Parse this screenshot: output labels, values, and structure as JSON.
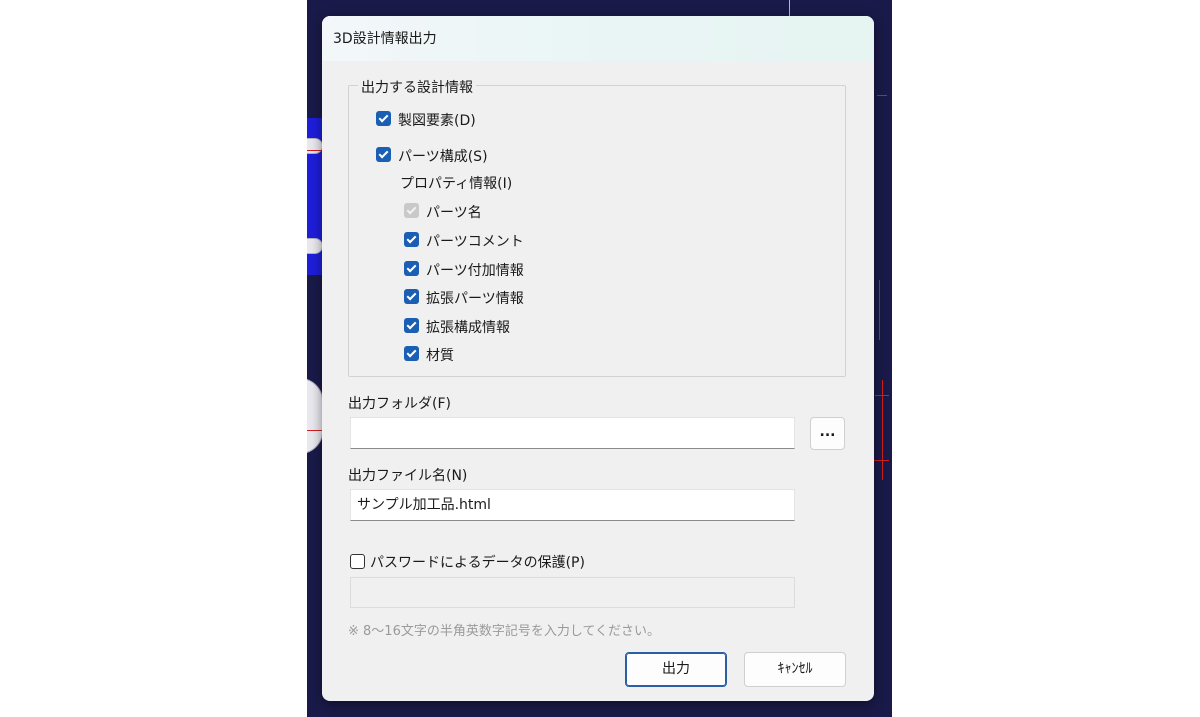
{
  "dialog": {
    "title": "3D設計情報出力"
  },
  "group": {
    "title": "出力する設計情報",
    "drawing_elements": {
      "label": "製図要素(D)",
      "checked": true
    },
    "parts_structure": {
      "label": "パーツ構成(S)",
      "checked": true
    },
    "property_info_label": "プロパティ情報(I)",
    "properties": [
      {
        "label": "パーツ名",
        "checked": true,
        "disabled": true
      },
      {
        "label": "パーツコメント",
        "checked": true
      },
      {
        "label": "パーツ付加情報",
        "checked": true
      },
      {
        "label": "拡張パーツ情報",
        "checked": true
      },
      {
        "label": "拡張構成情報",
        "checked": true
      },
      {
        "label": "材質",
        "checked": true
      }
    ]
  },
  "output_folder": {
    "label": "出力フォルダ(F)",
    "value": "",
    "browse_label": "..."
  },
  "output_filename": {
    "label": "出力ファイル名(N)",
    "value": "サンプル加工品.html"
  },
  "password": {
    "label": "パスワードによるデータの保護(P)",
    "checked": false,
    "value": "",
    "hint": "※ 8～16文字の半角英数字記号を入力してください。"
  },
  "buttons": {
    "ok": "出力",
    "cancel": "ｷｬﾝｾﾙ"
  },
  "colors": {
    "accent": "#1a5fb4",
    "dialog_bg": "#f0f0f0",
    "background_window": "#1a1a4a"
  }
}
